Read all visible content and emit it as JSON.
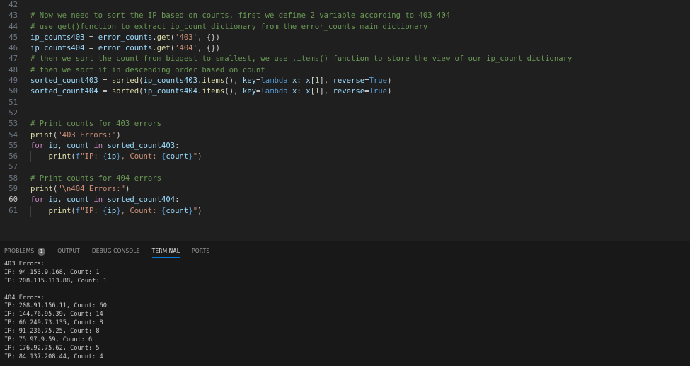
{
  "editor": {
    "lines": [
      {
        "num": "42",
        "segments": []
      },
      {
        "num": "43",
        "segments": [
          {
            "t": "cm",
            "v": "# Now we need to sort the IP based on counts, first we define 2 variable according to 403 404"
          }
        ]
      },
      {
        "num": "44",
        "segments": [
          {
            "t": "cm",
            "v": "# use get()function to extract ip_count dictionary from the error_counts main dictionary"
          }
        ]
      },
      {
        "num": "45",
        "segments": [
          {
            "t": "var",
            "v": "ip_counts403"
          },
          {
            "t": "op",
            "v": " = "
          },
          {
            "t": "var",
            "v": "error_counts"
          },
          {
            "t": "op",
            "v": "."
          },
          {
            "t": "fn",
            "v": "get"
          },
          {
            "t": "op",
            "v": "("
          },
          {
            "t": "str",
            "v": "'403'"
          },
          {
            "t": "op",
            "v": ", {})"
          }
        ]
      },
      {
        "num": "46",
        "segments": [
          {
            "t": "var",
            "v": "ip_counts404"
          },
          {
            "t": "op",
            "v": " = "
          },
          {
            "t": "var",
            "v": "error_counts"
          },
          {
            "t": "op",
            "v": "."
          },
          {
            "t": "fn",
            "v": "get"
          },
          {
            "t": "op",
            "v": "("
          },
          {
            "t": "str",
            "v": "'404'"
          },
          {
            "t": "op",
            "v": ", {})"
          }
        ]
      },
      {
        "num": "47",
        "segments": [
          {
            "t": "cm",
            "v": "# then we sort the count from biggest to smallest, we use .items() function to store the view of our ip_count dictionary"
          }
        ]
      },
      {
        "num": "48",
        "segments": [
          {
            "t": "cm",
            "v": "# then we sort it in descending order based on count"
          }
        ]
      },
      {
        "num": "49",
        "segments": [
          {
            "t": "var",
            "v": "sorted_count403"
          },
          {
            "t": "op",
            "v": " = "
          },
          {
            "t": "fn",
            "v": "sorted"
          },
          {
            "t": "op",
            "v": "("
          },
          {
            "t": "var",
            "v": "ip_counts403"
          },
          {
            "t": "op",
            "v": "."
          },
          {
            "t": "fn",
            "v": "items"
          },
          {
            "t": "op",
            "v": "(), "
          },
          {
            "t": "var",
            "v": "key"
          },
          {
            "t": "op",
            "v": "="
          },
          {
            "t": "kwb",
            "v": "lambda"
          },
          {
            "t": "op",
            "v": " "
          },
          {
            "t": "var",
            "v": "x"
          },
          {
            "t": "op",
            "v": ": "
          },
          {
            "t": "var",
            "v": "x"
          },
          {
            "t": "op",
            "v": "["
          },
          {
            "t": "num",
            "v": "1"
          },
          {
            "t": "op",
            "v": "], "
          },
          {
            "t": "var",
            "v": "reverse"
          },
          {
            "t": "op",
            "v": "="
          },
          {
            "t": "kwb",
            "v": "True"
          },
          {
            "t": "op",
            "v": ")"
          }
        ]
      },
      {
        "num": "50",
        "segments": [
          {
            "t": "var",
            "v": "sorted_count404"
          },
          {
            "t": "op",
            "v": " = "
          },
          {
            "t": "fn",
            "v": "sorted"
          },
          {
            "t": "op",
            "v": "("
          },
          {
            "t": "var",
            "v": "ip_counts404"
          },
          {
            "t": "op",
            "v": "."
          },
          {
            "t": "fn",
            "v": "items"
          },
          {
            "t": "op",
            "v": "(), "
          },
          {
            "t": "var",
            "v": "key"
          },
          {
            "t": "op",
            "v": "="
          },
          {
            "t": "kwb",
            "v": "lambda"
          },
          {
            "t": "op",
            "v": " "
          },
          {
            "t": "var",
            "v": "x"
          },
          {
            "t": "op",
            "v": ": "
          },
          {
            "t": "var",
            "v": "x"
          },
          {
            "t": "op",
            "v": "["
          },
          {
            "t": "num",
            "v": "1"
          },
          {
            "t": "op",
            "v": "], "
          },
          {
            "t": "var",
            "v": "reverse"
          },
          {
            "t": "op",
            "v": "="
          },
          {
            "t": "kwb",
            "v": "True"
          },
          {
            "t": "op",
            "v": ")"
          }
        ]
      },
      {
        "num": "51",
        "segments": []
      },
      {
        "num": "52",
        "segments": []
      },
      {
        "num": "53",
        "segments": [
          {
            "t": "cm",
            "v": "# Print counts for 403 errors"
          }
        ]
      },
      {
        "num": "54",
        "segments": [
          {
            "t": "fn",
            "v": "print"
          },
          {
            "t": "op",
            "v": "("
          },
          {
            "t": "str",
            "v": "\"403 Errors:\""
          },
          {
            "t": "op",
            "v": ")"
          }
        ]
      },
      {
        "num": "55",
        "segments": [
          {
            "t": "kw",
            "v": "for"
          },
          {
            "t": "op",
            "v": " "
          },
          {
            "t": "var",
            "v": "ip"
          },
          {
            "t": "op",
            "v": ", "
          },
          {
            "t": "var",
            "v": "count"
          },
          {
            "t": "op",
            "v": " "
          },
          {
            "t": "kw",
            "v": "in"
          },
          {
            "t": "op",
            "v": " "
          },
          {
            "t": "var",
            "v": "sorted_count403"
          },
          {
            "t": "op",
            "v": ":"
          }
        ]
      },
      {
        "num": "56",
        "indent": true,
        "segments": [
          {
            "t": "op",
            "v": "    "
          },
          {
            "t": "fn",
            "v": "print"
          },
          {
            "t": "op",
            "v": "("
          },
          {
            "t": "kwb",
            "v": "f"
          },
          {
            "t": "str",
            "v": "\"IP: "
          },
          {
            "t": "brace",
            "v": "{"
          },
          {
            "t": "var",
            "v": "ip"
          },
          {
            "t": "brace",
            "v": "}"
          },
          {
            "t": "str",
            "v": ", Count: "
          },
          {
            "t": "brace",
            "v": "{"
          },
          {
            "t": "var",
            "v": "count"
          },
          {
            "t": "brace",
            "v": "}"
          },
          {
            "t": "str",
            "v": "\""
          },
          {
            "t": "op",
            "v": ")"
          }
        ]
      },
      {
        "num": "57",
        "segments": []
      },
      {
        "num": "58",
        "segments": [
          {
            "t": "cm",
            "v": "# Print counts for 404 errors"
          }
        ]
      },
      {
        "num": "59",
        "segments": [
          {
            "t": "fn",
            "v": "print"
          },
          {
            "t": "op",
            "v": "("
          },
          {
            "t": "str",
            "v": "\"\\n404 Errors:\""
          },
          {
            "t": "op",
            "v": ")"
          }
        ]
      },
      {
        "num": "60",
        "current": true,
        "segments": [
          {
            "t": "kw",
            "v": "for"
          },
          {
            "t": "op",
            "v": " "
          },
          {
            "t": "var",
            "v": "ip"
          },
          {
            "t": "op",
            "v": ", "
          },
          {
            "t": "var",
            "v": "count"
          },
          {
            "t": "op",
            "v": " "
          },
          {
            "t": "kw",
            "v": "in"
          },
          {
            "t": "op",
            "v": " "
          },
          {
            "t": "var",
            "v": "sorted_count404"
          },
          {
            "t": "op",
            "v": ":"
          }
        ]
      },
      {
        "num": "61",
        "indent": true,
        "segments": [
          {
            "t": "op",
            "v": "    "
          },
          {
            "t": "fn",
            "v": "print"
          },
          {
            "t": "op",
            "v": "("
          },
          {
            "t": "kwb",
            "v": "f"
          },
          {
            "t": "str",
            "v": "\"IP: "
          },
          {
            "t": "brace",
            "v": "{"
          },
          {
            "t": "var",
            "v": "ip"
          },
          {
            "t": "brace",
            "v": "}"
          },
          {
            "t": "str",
            "v": ", Count: "
          },
          {
            "t": "brace",
            "v": "{"
          },
          {
            "t": "var",
            "v": "count"
          },
          {
            "t": "brace",
            "v": "}"
          },
          {
            "t": "str",
            "v": "\""
          },
          {
            "t": "op",
            "v": ")"
          }
        ]
      }
    ]
  },
  "panel": {
    "tabs": [
      {
        "label": "PROBLEMS",
        "name": "tab-problems",
        "badge": "1"
      },
      {
        "label": "OUTPUT",
        "name": "tab-output"
      },
      {
        "label": "DEBUG CONSOLE",
        "name": "tab-debug-console"
      },
      {
        "label": "TERMINAL",
        "name": "tab-terminal",
        "active": true
      },
      {
        "label": "PORTS",
        "name": "tab-ports"
      }
    ],
    "terminal_lines": [
      "403 Errors:",
      "IP: 94.153.9.168, Count: 1",
      "IP: 208.115.113.88, Count: 1",
      "",
      "404 Errors:",
      "IP: 208.91.156.11, Count: 60",
      "IP: 144.76.95.39, Count: 14",
      "IP: 66.249.73.135, Count: 8",
      "IP: 91.236.75.25, Count: 8",
      "IP: 75.97.9.59, Count: 6",
      "IP: 176.92.75.62, Count: 5",
      "IP: 84.137.208.44, Count: 4"
    ]
  },
  "colors": {
    "background": "#1f1f1f",
    "panel_background": "#181818",
    "active_tab_underline": "#0078d4"
  }
}
